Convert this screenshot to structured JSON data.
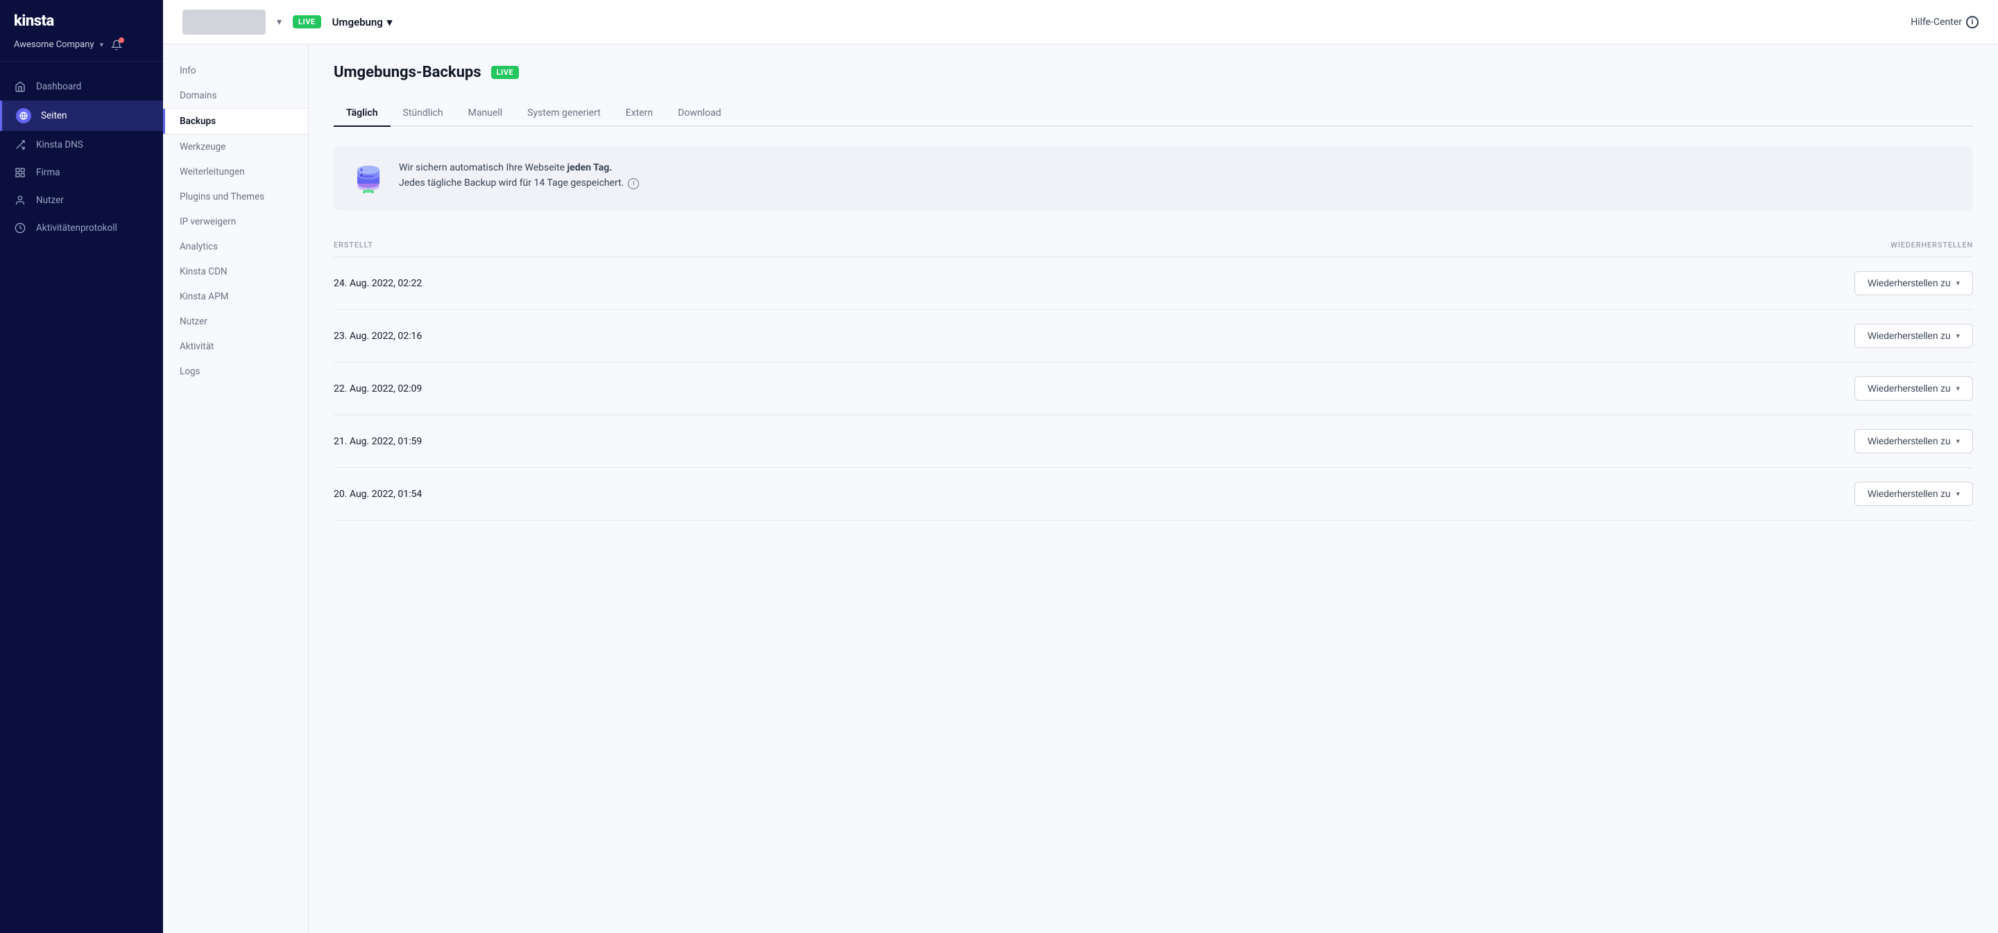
{
  "brand": {
    "logo": "kinsta",
    "logo_accent": "a"
  },
  "company": {
    "name": "Awesome Company",
    "chevron": "▾"
  },
  "sidebar": {
    "nav_items": [
      {
        "id": "dashboard",
        "label": "Dashboard",
        "icon": "⊞",
        "active": false
      },
      {
        "id": "seiten",
        "label": "Seiten",
        "icon": "◉",
        "active": true
      },
      {
        "id": "kinsta-dns",
        "label": "Kinsta DNS",
        "icon": "↔",
        "active": false
      },
      {
        "id": "firma",
        "label": "Firma",
        "icon": "▦",
        "active": false
      },
      {
        "id": "nutzer",
        "label": "Nutzer",
        "icon": "👤",
        "active": false
      },
      {
        "id": "aktivitaet",
        "label": "Aktivitätenprotokoll",
        "icon": "◎",
        "active": false
      }
    ]
  },
  "topbar": {
    "live_badge": "LIVE",
    "environment_label": "Umgebung",
    "hilfe_center": "Hilfe-Center"
  },
  "sub_nav": {
    "items": [
      {
        "id": "info",
        "label": "Info",
        "active": false
      },
      {
        "id": "domains",
        "label": "Domains",
        "active": false
      },
      {
        "id": "backups",
        "label": "Backups",
        "active": true
      },
      {
        "id": "werkzeuge",
        "label": "Werkzeuge",
        "active": false
      },
      {
        "id": "weiterleitungen",
        "label": "Weiterleitungen",
        "active": false
      },
      {
        "id": "plugins-themes",
        "label": "Plugins und Themes",
        "active": false
      },
      {
        "id": "ip-verweigern",
        "label": "IP verweigern",
        "active": false
      },
      {
        "id": "analytics",
        "label": "Analytics",
        "active": false
      },
      {
        "id": "kinsta-cdn",
        "label": "Kinsta CDN",
        "active": false
      },
      {
        "id": "kinsta-apm",
        "label": "Kinsta APM",
        "active": false
      },
      {
        "id": "nutzer",
        "label": "Nutzer",
        "active": false
      },
      {
        "id": "aktivitaet",
        "label": "Aktivität",
        "active": false
      },
      {
        "id": "logs",
        "label": "Logs",
        "active": false
      }
    ]
  },
  "page": {
    "title": "Umgebungs-Backups",
    "live_badge": "LIVE",
    "tabs": [
      {
        "id": "taeglich",
        "label": "Täglich",
        "active": true
      },
      {
        "id": "stuendlich",
        "label": "Stündlich",
        "active": false
      },
      {
        "id": "manuell",
        "label": "Manuell",
        "active": false
      },
      {
        "id": "system",
        "label": "System generiert",
        "active": false
      },
      {
        "id": "extern",
        "label": "Extern",
        "active": false
      },
      {
        "id": "download",
        "label": "Download",
        "active": false
      }
    ],
    "info_text_line1": "Wir sichern automatisch Ihre Webseite ",
    "info_text_bold": "jeden Tag.",
    "info_text_line2": "Jedes tägliche Backup wird für 14 Tage gespeichert.",
    "table": {
      "col_created": "ERSTELLT",
      "col_restore": "WIEDERHERSTELLEN",
      "rows": [
        {
          "date": "24. Aug. 2022, 02:22",
          "btn_label": "Wiederherstellen zu"
        },
        {
          "date": "23. Aug. 2022, 02:16",
          "btn_label": "Wiederherstellen zu"
        },
        {
          "date": "22. Aug. 2022, 02:09",
          "btn_label": "Wiederherstellen zu"
        },
        {
          "date": "21. Aug. 2022, 01:59",
          "btn_label": "Wiederherstellen zu"
        },
        {
          "date": "20. Aug. 2022, 01:54",
          "btn_label": "Wiederherstellen zu"
        }
      ]
    }
  }
}
